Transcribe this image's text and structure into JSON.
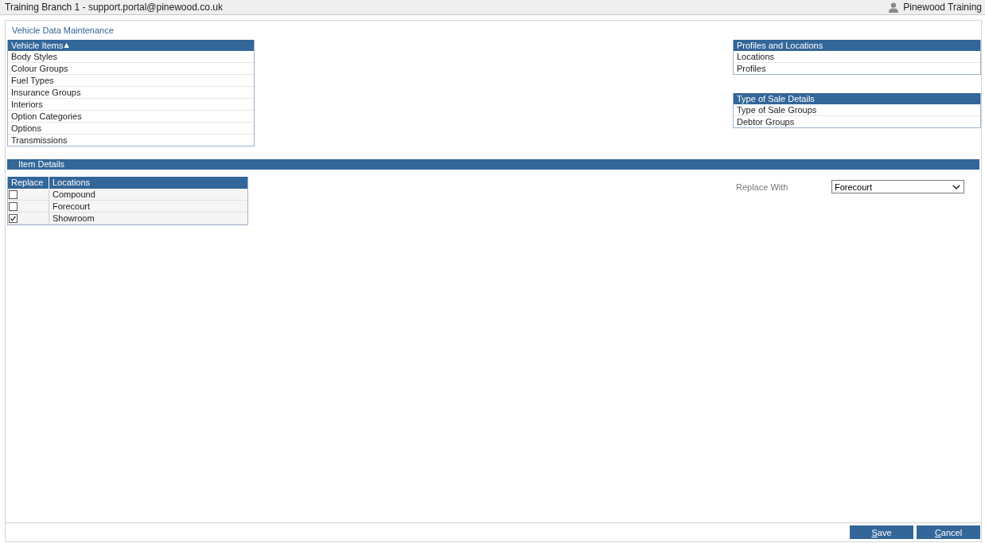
{
  "top_bar": {
    "branch": "Training Branch 1 - support.portal@pinewood.co.uk",
    "user": "Pinewood Training"
  },
  "page": {
    "title": "Vehicle Data Maintenance"
  },
  "left_lists": [
    {
      "title": "Vehicle Items",
      "sort_arrow": "▲",
      "items": [
        {
          "label": "Body Styles",
          "selected": false
        },
        {
          "label": "Colour Groups",
          "selected": false
        },
        {
          "label": "Fuel Types",
          "selected": false
        },
        {
          "label": "Insurance Groups",
          "selected": false
        },
        {
          "label": "Interiors",
          "selected": false
        },
        {
          "label": "Option Categories",
          "selected": false
        },
        {
          "label": "Options",
          "selected": false
        },
        {
          "label": "Transmissions",
          "selected": false
        }
      ]
    }
  ],
  "right_lists": [
    {
      "title": "Profiles and Locations",
      "items": [
        {
          "label": "Locations",
          "selected": false
        },
        {
          "label": "Profiles",
          "selected": false
        }
      ]
    },
    {
      "title": "Type of Sale Details",
      "items": [
        {
          "label": "Type of Sale Groups",
          "selected": false
        },
        {
          "label": "Debtor Groups",
          "selected": false
        }
      ]
    }
  ],
  "item_details": {
    "title": "Item Details",
    "table": {
      "columns": [
        "Replace",
        "Locations"
      ],
      "rows": [
        {
          "location": "Compound",
          "checked": false
        },
        {
          "location": "Forecourt",
          "checked": false
        },
        {
          "location": "Showroom",
          "checked": true
        }
      ]
    },
    "replace_with": {
      "label": "Replace With",
      "value": "Forecourt"
    }
  },
  "buttons": [
    {
      "label": "Save",
      "access_key": true
    },
    {
      "label": "Cancel",
      "access_key": true
    }
  ]
}
